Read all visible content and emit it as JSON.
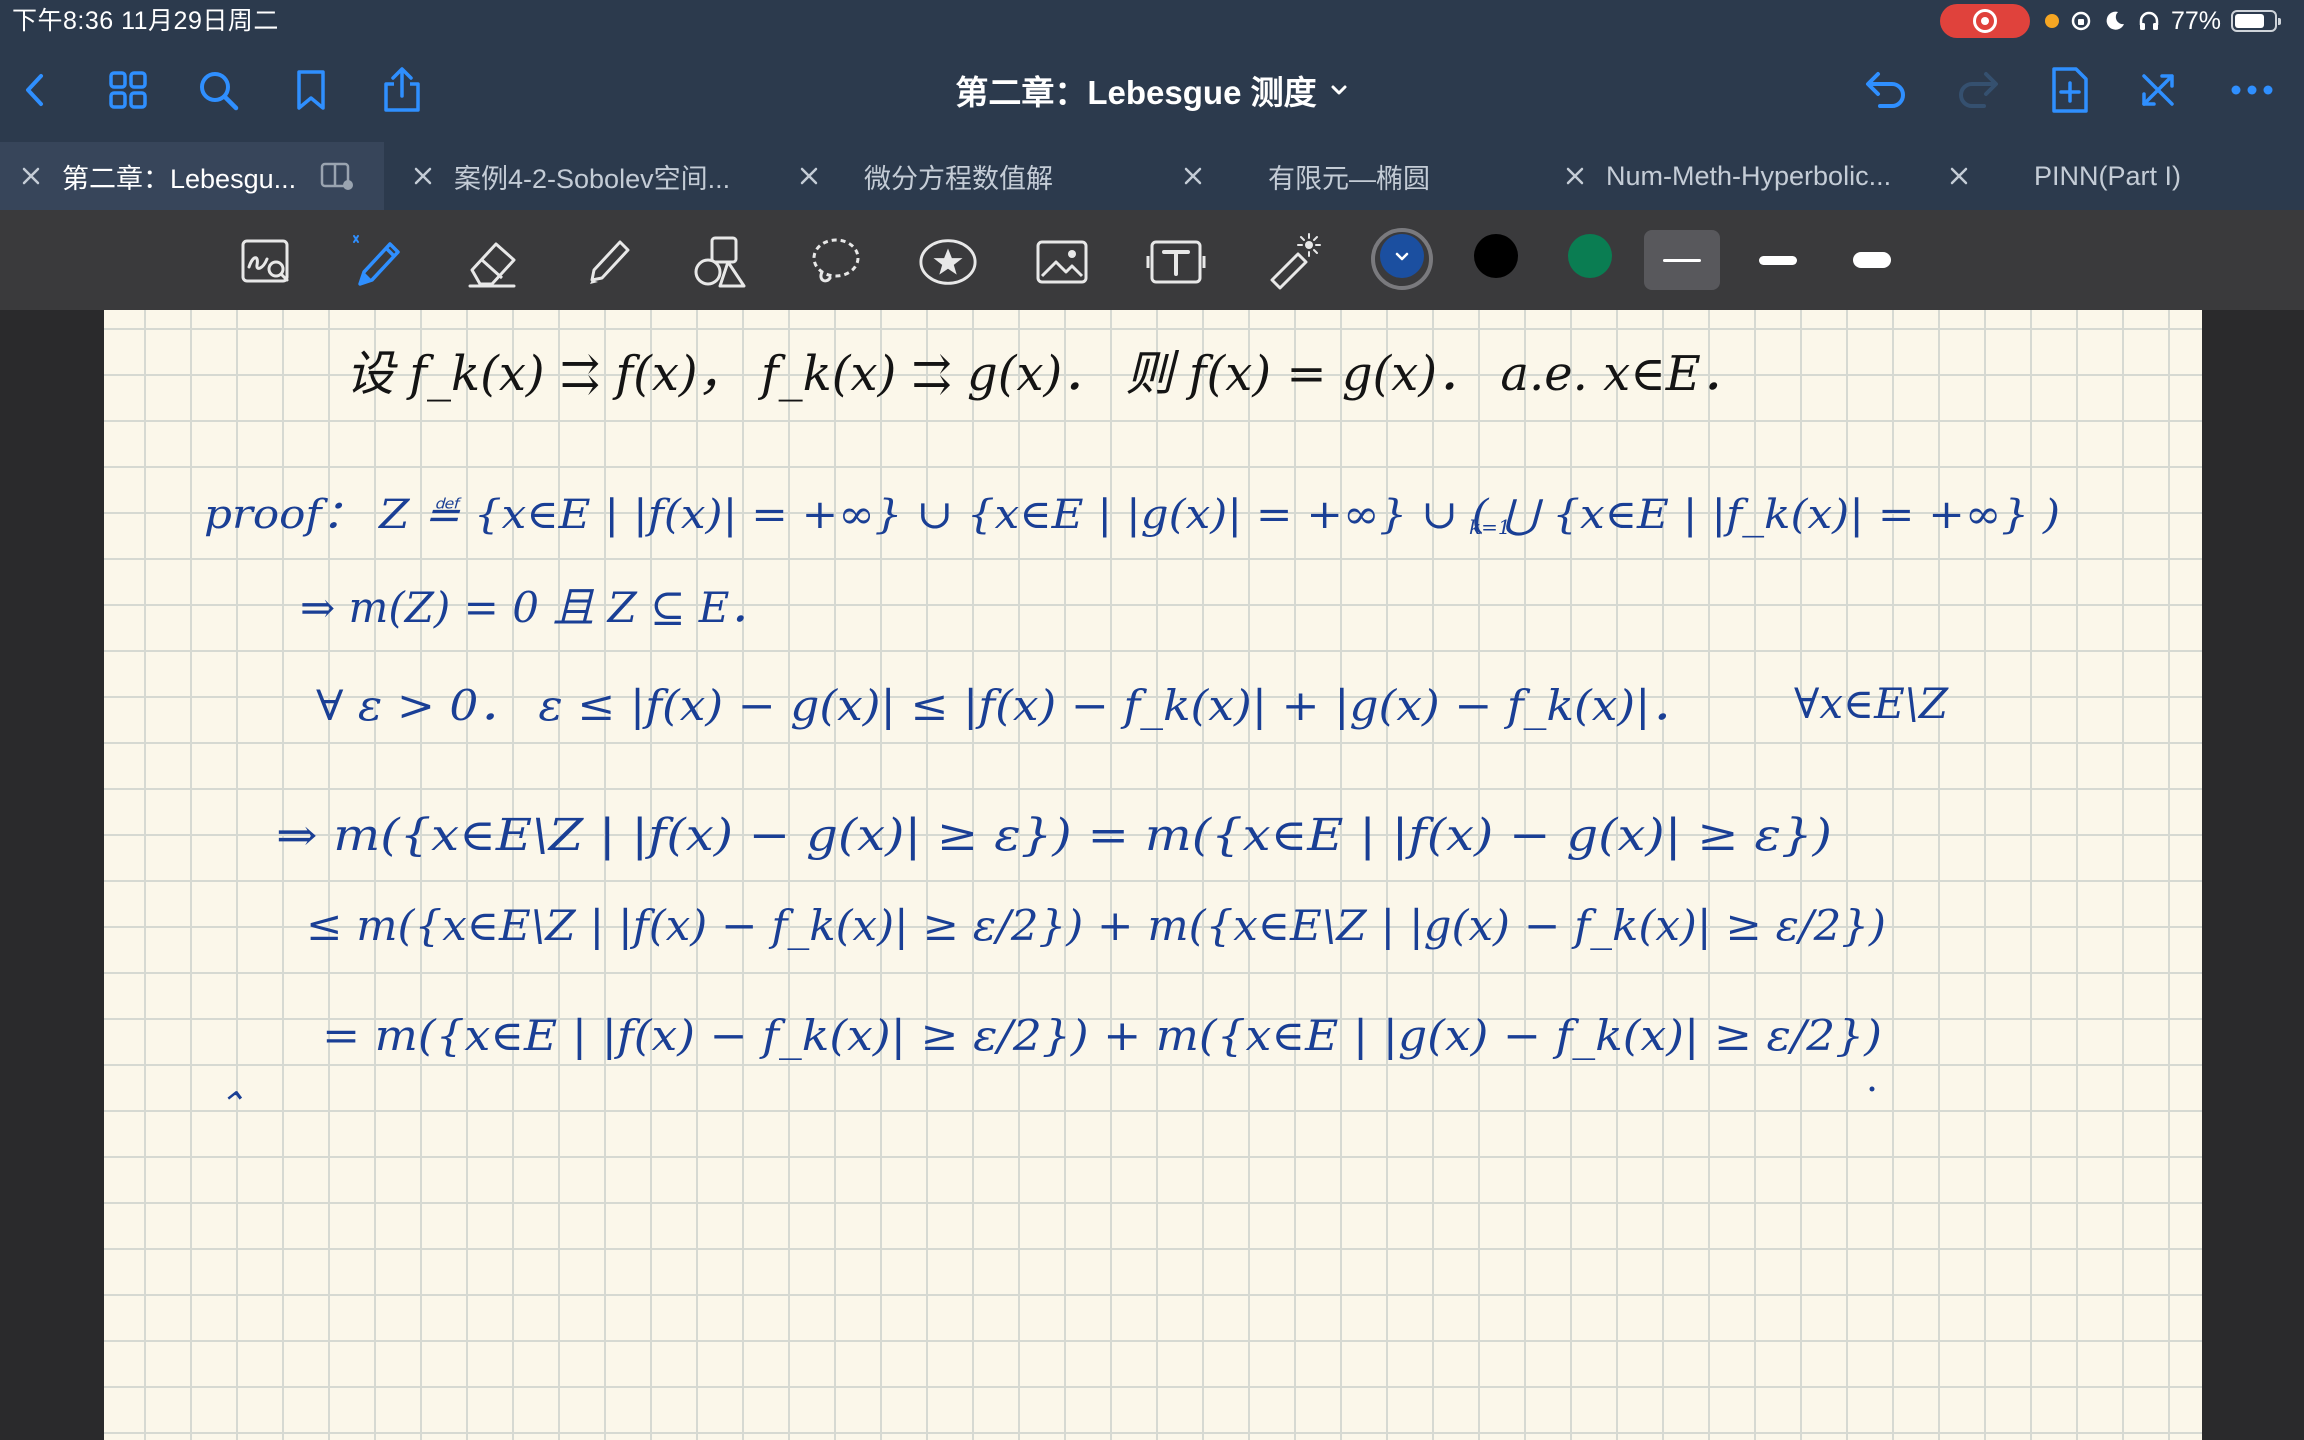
{
  "status_bar": {
    "time": "下午8:36   11月29日周二",
    "battery": "77%",
    "battery_level": 0.77
  },
  "nav": {
    "document_title": "第二章：Lebesgue 测度",
    "icons": [
      "back-icon",
      "grid-icon",
      "search-icon",
      "bookmark-icon",
      "share-icon",
      "undo-icon",
      "redo-icon",
      "add-page-icon",
      "close-toolbar-icon",
      "more-icon"
    ]
  },
  "tabs": [
    {
      "label": "第二章：Lebesgu...",
      "active": true
    },
    {
      "label": "案例4-2-Sobolev空间...",
      "active": false
    },
    {
      "label": "微分方程数值解",
      "active": false
    },
    {
      "label": "有限元—椭圆",
      "active": false
    },
    {
      "label": "Num-Meth-Hyperbolic...",
      "active": false
    },
    {
      "label": "PINN(Part I)",
      "active": false
    }
  ],
  "toolbar": {
    "tools": [
      "handwriting-zoom-icon",
      "pen-icon",
      "eraser-icon",
      "highlighter-icon",
      "shapes-icon",
      "lasso-icon",
      "sticker-icon",
      "image-icon",
      "text-icon",
      "laser-pointer-icon"
    ],
    "colors": [
      "#1b4fa0",
      "#000000",
      "#0a7d52"
    ],
    "selected_color": "#1b4fa0",
    "stroke_widths": [
      "thin",
      "medium",
      "thick"
    ],
    "selected_stroke": "thin"
  },
  "notes": {
    "line1_black": "设  f_k(x) ⇉ f(x)，  f_k(x) ⇉ g(x)．  则  f(x) = g(x)．  a.e. x∈E．",
    "line2": "proof：  Z ≝ {x∈E | |f(x)| = +∞} ∪ {x∈E | |g(x)| = +∞} ∪ ( ⋃ {x∈E | |f_k(x)| = +∞} )",
    "line2_union_index": "k=1",
    "line3": "⇒  m(Z) = 0   且   Z ⊆ E．",
    "line4a": "∀ ε > 0．    ε ≤ |f(x) − g(x)| ≤ |f(x) − f_k(x)| + |g(x) − f_k(x)|．",
    "line4b": "∀x∈E\\Z",
    "line5": "⇒  m({x∈E\\Z  |  |f(x) − g(x)| ≥ ε}) = m({x∈E | |f(x) − g(x)| ≥ ε})",
    "line6": "≤  m({x∈E\\Z | |f(x) − f_k(x)| ≥ ε/2}) + m({x∈E\\Z | |g(x) − f_k(x)| ≥ ε/2})",
    "line7": "=  m({x∈E | |f(x) − f_k(x)| ≥ ε/2}) + m({x∈E | |g(x) − f_k(x)| ≥ ε/2})",
    "line8": "⌃"
  }
}
